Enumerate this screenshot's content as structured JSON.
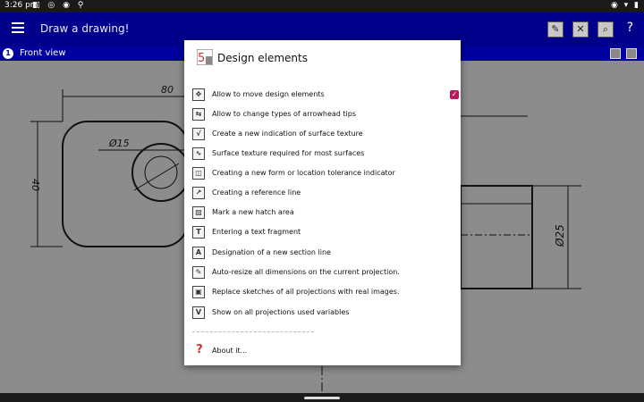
{
  "status": {
    "time": "3:26 pm"
  },
  "appbar": {
    "title": "Draw a drawing!",
    "help_label": "?"
  },
  "viewbar": {
    "number": "1",
    "label": "Front view"
  },
  "drawing": {
    "dim_80": "80",
    "dim_40": "40",
    "dim_d15": "Ø15",
    "dim_d25": "Ø25"
  },
  "dialog": {
    "title": "Design elements",
    "items": [
      {
        "label": "Allow to move design elements",
        "icon": "move-elements-icon",
        "glyph": "✥",
        "checked": true
      },
      {
        "label": "Allow to change types of arrowhead tips",
        "icon": "arrowhead-icon",
        "glyph": "⇆"
      },
      {
        "label": "Create a new indication of surface texture",
        "icon": "surface-texture-icon",
        "glyph": "√"
      },
      {
        "label": "Surface texture required for most surfaces",
        "icon": "surface-texture-most-icon",
        "glyph": "∿"
      },
      {
        "label": "Creating a new form or location tolerance indicator",
        "icon": "tolerance-icon",
        "glyph": "◫"
      },
      {
        "label": "Creating a reference line",
        "icon": "reference-line-icon",
        "glyph": "↗"
      },
      {
        "label": "Mark a new hatch area",
        "icon": "hatch-area-icon",
        "glyph": "▨"
      },
      {
        "label": "Entering a text fragment",
        "icon": "text-fragment-icon",
        "glyph": "T"
      },
      {
        "label": "Designation of a new section line",
        "icon": "section-line-icon",
        "glyph": "A"
      },
      {
        "label": "Auto-resize all dimensions on the current projection.",
        "icon": "auto-resize-icon",
        "glyph": "✎"
      },
      {
        "label": "Replace sketches of all projections with real images.",
        "icon": "replace-sketches-icon",
        "glyph": "▣"
      },
      {
        "label": "Show on all projections used variables",
        "icon": "variables-icon",
        "glyph": "V"
      }
    ],
    "about_label": "About it..."
  },
  "colors": {
    "appbar": "#00008a",
    "viewbar": "#0000a0",
    "check": "#c2185b",
    "about": "#d32f2f"
  }
}
